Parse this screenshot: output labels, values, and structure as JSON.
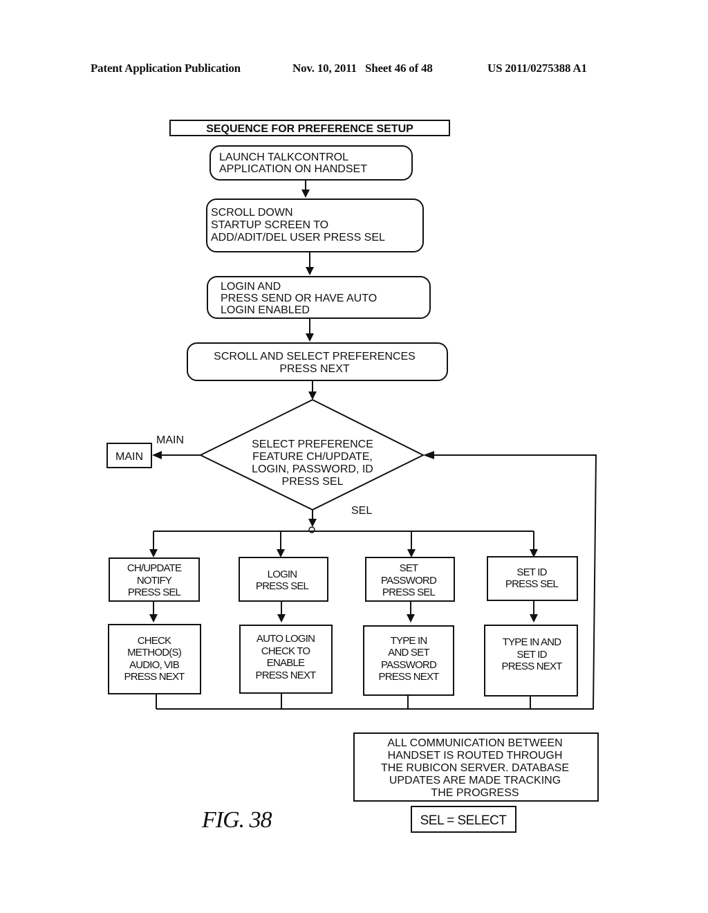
{
  "header": {
    "publication": "Patent Application Publication",
    "date_sheet": "Nov. 10, 2011   Sheet 46 of 48",
    "patent_number": "US 2011/0275388 A1"
  },
  "diagram": {
    "title": "SEQUENCE FOR PREFERENCE SETUP",
    "steps": [
      {
        "lines": [
          "LAUNCH TALKCONTROL",
          "APPLICATION ON HANDSET"
        ]
      },
      {
        "lines": [
          "SCROLL DOWN",
          "STARTUP SCREEN TO",
          "ADD/ADIT/DEL USER PRESS SEL"
        ]
      },
      {
        "lines": [
          "LOGIN AND",
          "PRESS SEND OR HAVE AUTO",
          "LOGIN ENABLED"
        ]
      },
      {
        "lines": [
          "SCROLL AND SELECT PREFERENCES",
          "PRESS NEXT"
        ]
      }
    ],
    "decision": {
      "lines": [
        "SELECT PREFERENCE",
        "FEATURE CH/UPDATE,",
        "LOGIN, PASSWORD, ID",
        "PRESS SEL"
      ],
      "left_branch_label": "MAIN",
      "down_branch_label": "SEL"
    },
    "main_box": "MAIN",
    "branches": [
      {
        "select": [
          "CH/UPDATE",
          "NOTIFY",
          "PRESS SEL"
        ],
        "action": [
          "CHECK",
          "METHOD(S)",
          "AUDIO, VIB",
          "PRESS NEXT"
        ]
      },
      {
        "select": [
          "LOGIN",
          "PRESS SEL"
        ],
        "action": [
          "AUTO LOGIN",
          "CHECK TO",
          "ENABLE",
          "PRESS NEXT"
        ]
      },
      {
        "select": [
          "SET",
          "PASSWORD",
          "PRESS SEL"
        ],
        "action": [
          "TYPE IN",
          "AND SET",
          "PASSWORD",
          "PRESS NEXT"
        ]
      },
      {
        "select": [
          "SET ID",
          "PRESS SEL"
        ],
        "action": [
          "TYPE IN AND",
          "SET ID",
          "PRESS NEXT"
        ]
      }
    ],
    "note": [
      "ALL COMMUNICATION BETWEEN",
      "HANDSET IS ROUTED THROUGH",
      "THE RUBICON SERVER.  DATABASE",
      "UPDATES ARE MADE TRACKING",
      "THE PROGRESS"
    ],
    "legend": "SEL = SELECT",
    "figure_label": "FIG. 38"
  }
}
